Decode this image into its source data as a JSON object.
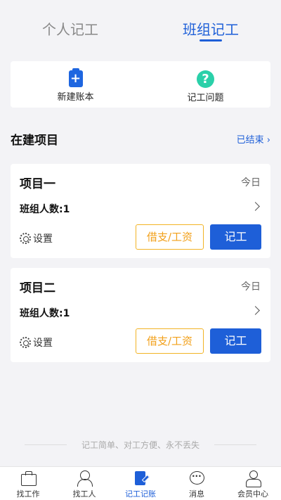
{
  "tabs": [
    {
      "label": "个人记工",
      "active": false
    },
    {
      "label": "班组记工",
      "active": true
    }
  ],
  "quick_actions": [
    {
      "label": "新建账本",
      "icon": "new-ledger-icon"
    },
    {
      "label": "记工问题",
      "icon": "question-icon"
    }
  ],
  "section": {
    "title": "在建项目",
    "ended_link": "已结束"
  },
  "projects": [
    {
      "name": "项目一",
      "date": "今日",
      "members": "班组人数:1",
      "settings": "设置",
      "borrow_label": "借支/工资",
      "record_label": "记工"
    },
    {
      "name": "项目二",
      "date": "今日",
      "members": "班组人数:1",
      "settings": "设置",
      "borrow_label": "借支/工资",
      "record_label": "记工"
    }
  ],
  "slogan": "记工简单、对工方便、永不丢失",
  "bottom_nav": [
    {
      "label": "找工作",
      "icon": "briefcase-icon",
      "active": false
    },
    {
      "label": "找工人",
      "icon": "worker-icon",
      "active": false
    },
    {
      "label": "记工记账",
      "icon": "notebook-icon",
      "active": true
    },
    {
      "label": "消息",
      "icon": "chat-icon",
      "active": false
    },
    {
      "label": "会员中心",
      "icon": "member-icon",
      "active": false
    }
  ],
  "colors": {
    "primary": "#1e5fd8",
    "warning": "#f2a01a",
    "help": "#2ad0a9",
    "background": "#f3f3f6"
  }
}
